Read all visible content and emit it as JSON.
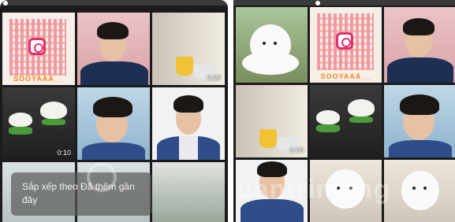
{
  "left_grid": {
    "qr_username": "SOOYAAA__",
    "durations": {
      "kitchen": "0:09",
      "food": "0:10"
    },
    "toast": "Sắp xếp theo Đã thêm gần đây"
  },
  "right_grid": {
    "qr_username": "SOOYAAA__",
    "durations": {
      "kitchen": "0:09"
    }
  },
  "watermark": {
    "text": "uantrimang"
  },
  "colors": {
    "accent_instagram": "#e1306c",
    "username_orange": "#f08a1d",
    "panel_bg": "#1b1b1b"
  }
}
